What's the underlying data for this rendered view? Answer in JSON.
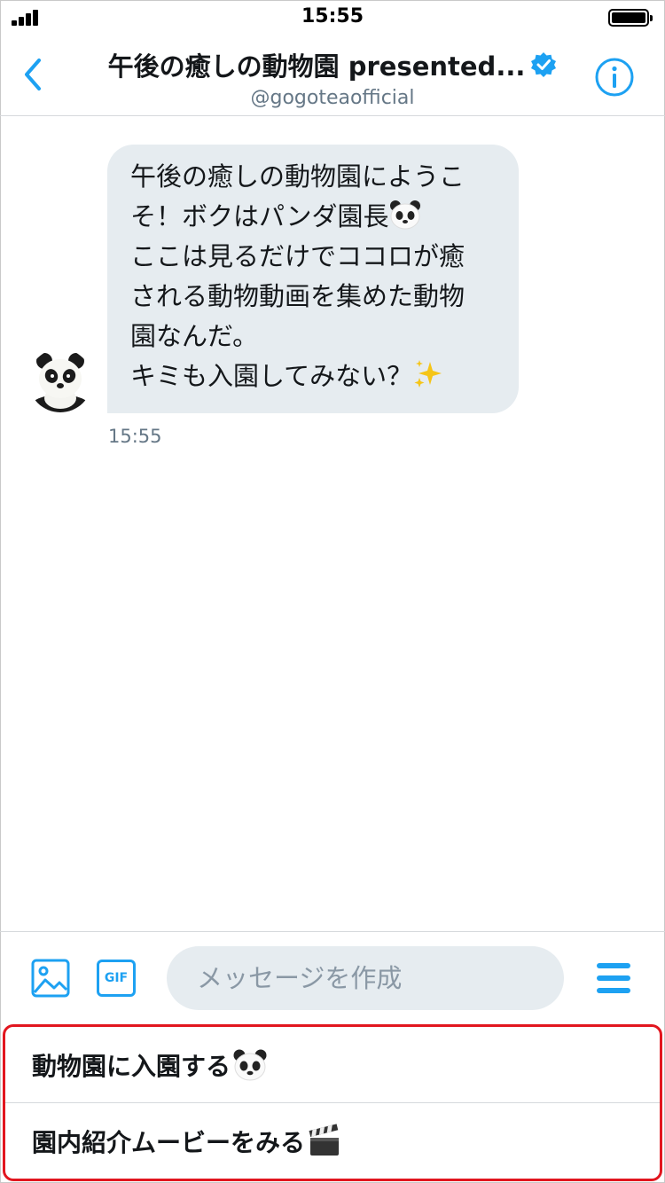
{
  "status_bar": {
    "time": "15:55"
  },
  "header": {
    "title": "午後の癒しの動物園 presented...",
    "handle": "@gogoteaofficial"
  },
  "message": {
    "lines": [
      "午後の癒しの動物園にようこ",
      "そ！ボクはパンダ園長",
      "ここは見るだけでココロが癒",
      "される動物動画を集めた動物",
      "園なんだ。",
      "キミも入園してみない？"
    ],
    "time": "15:55"
  },
  "composer": {
    "gif_label": "GIF",
    "placeholder": "メッセージを作成"
  },
  "quick_replies": [
    {
      "label": "動物園に入園する"
    },
    {
      "label": "園内紹介ムービーをみる"
    }
  ],
  "colors": {
    "accent": "#1da1f2",
    "bubble": "#e6ecf0",
    "highlight_border": "#e2161f"
  },
  "icons": [
    "signal-icon",
    "battery-icon",
    "back-icon",
    "verified-icon",
    "info-icon",
    "image-icon",
    "gif-icon",
    "menu-icon",
    "panda-emoji-icon",
    "sparkles-icon",
    "clapper-board-icon"
  ]
}
